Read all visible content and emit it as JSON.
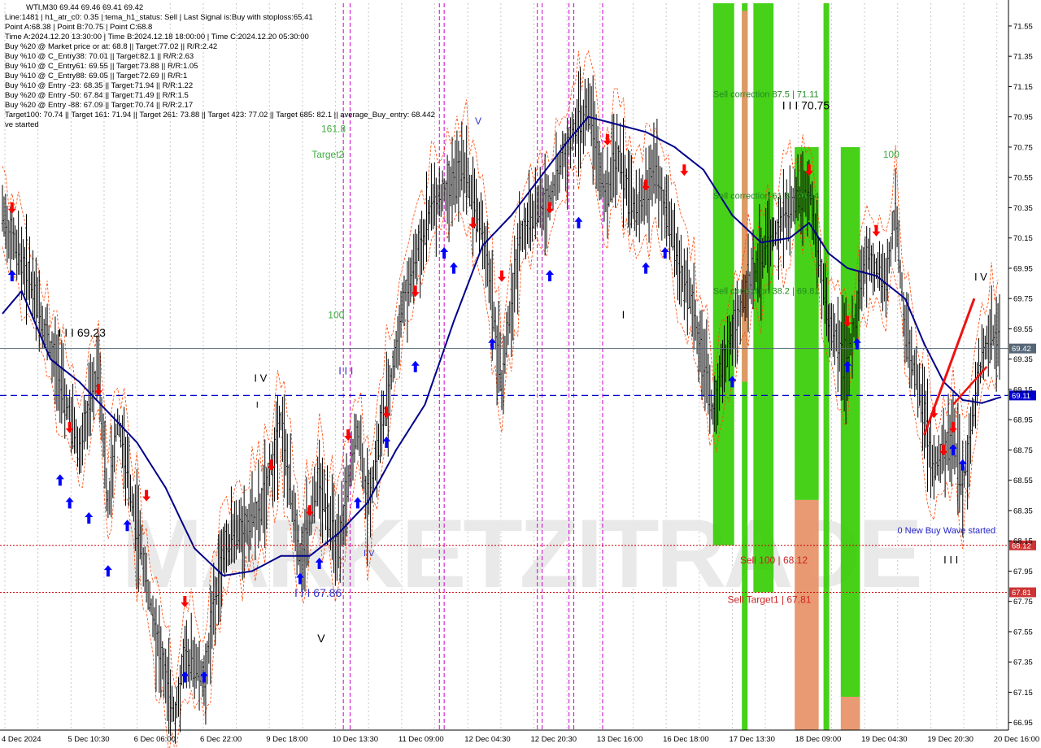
{
  "symbol_header": "WTI,M30  69.44 69.46 69.41 69.42",
  "info_lines": [
    "Line:1481  |  h1_atr_c0: 0.35  |  tema_h1_status: Sell  |  Last Signal is:Buy with stoploss:65.41",
    "Point A:68.38  |  Point B:70.75  |  Point C:68.8",
    "Time A:2024.12.20 13:30:00  |  Time B:2024.12.18 18:00:00  |  Time C:2024.12.20 05:30:00",
    "Buy %20 @ Market price or at: 68.8  ||  Target:77.02  ||  R/R:2.42",
    "Buy %10 @ C_Entry38: 70.01  ||  Target:82.1  ||  R/R:2.63",
    "Buy %10 @ C_Entry61: 69.55  ||  Target:73.88  ||  R/R:1.05",
    "Buy %10 @ C_Entry88: 69.05  ||  Target:72.69  ||  R/R:1",
    "Buy %10 @ Entry -23: 68.35  ||  Target:71.94  ||  R/R:1.22",
    "Buy %20 @ Entry -50: 67.84  ||  Target:71.49  ||  R/R:1.5",
    "Buy %20 @ Entry -88: 67.09  ||  Target:70.74  ||  R/R:2.17",
    "Target100: 70.74  ||  Target 161: 71.94  ||  Target 261: 73.88  ||  Target 423: 77.02  ||  Target 685: 82.1  ||  average_Buy_entry: 68.442",
    "ve started"
  ],
  "watermark": "MARKETZITRADE",
  "colors": {
    "price_bars": "#000000",
    "ma": "#00008b",
    "bands": "#ff4500",
    "green_zone": "#33cc00",
    "orange_zone": "#e8956a",
    "buy_arrow": "#0000ff",
    "sell_arrow": "#ff0000",
    "current_price": "#556677",
    "blue_level": "#0000cc",
    "red_level": "#cc0000",
    "magenta_vline": "#cc00cc",
    "grid": "#c8c8c8"
  },
  "chart_data": {
    "type": "candlestick",
    "title": "WTI,M30",
    "x_ticks": [
      "4 Dec 2024",
      "5 Dec 10:30",
      "6 Dec 06:00",
      "6 Dec 22:00",
      "9 Dec 18:00",
      "10 Dec 13:30",
      "11 Dec 09:00",
      "12 Dec 04:30",
      "12 Dec 20:30",
      "13 Dec 16:00",
      "16 Dec 18:00",
      "17 Dec 13:30",
      "18 Dec 09:00",
      "19 Dec 04:30",
      "19 Dec 20:30",
      "20 Dec 16:00"
    ],
    "y_ticks": [
      "71.55",
      "71.35",
      "71.15",
      "70.95",
      "70.75",
      "70.55",
      "70.35",
      "70.15",
      "69.95",
      "69.75",
      "69.55",
      "69.35",
      "69.15",
      "68.95",
      "68.75",
      "68.55",
      "68.35",
      "68.15",
      "67.95",
      "67.75",
      "67.55",
      "67.35",
      "67.15",
      "66.95"
    ],
    "ylim": [
      66.9,
      71.7
    ],
    "price_path": [
      [
        0,
        70.3
      ],
      [
        3,
        69.85
      ],
      [
        6,
        69.2
      ],
      [
        8,
        68.75
      ],
      [
        10,
        69.3
      ],
      [
        11,
        68.4
      ],
      [
        12,
        68.95
      ],
      [
        16,
        67.55
      ],
      [
        18,
        67.0
      ],
      [
        19,
        67.4
      ],
      [
        21,
        67.25
      ],
      [
        23,
        68.1
      ],
      [
        27,
        68.35
      ],
      [
        29,
        68.95
      ],
      [
        31,
        68.05
      ],
      [
        33,
        68.55
      ],
      [
        35,
        68.1
      ],
      [
        37,
        68.9
      ],
      [
        38,
        68.4
      ],
      [
        40,
        69.05
      ],
      [
        42,
        69.8
      ],
      [
        45,
        70.4
      ],
      [
        48,
        70.6
      ],
      [
        50,
        70.2
      ],
      [
        51,
        69.7
      ],
      [
        52,
        69.2
      ],
      [
        54,
        70.2
      ],
      [
        57,
        70.4
      ],
      [
        59,
        70.8
      ],
      [
        61,
        71.0
      ],
      [
        63,
        70.4
      ],
      [
        64,
        70.7
      ],
      [
        66,
        70.3
      ],
      [
        68,
        70.6
      ],
      [
        70,
        70.1
      ],
      [
        72,
        69.65
      ],
      [
        74,
        69.0
      ],
      [
        75,
        69.3
      ],
      [
        78,
        69.9
      ],
      [
        81,
        70.25
      ],
      [
        84,
        70.5
      ],
      [
        86,
        69.6
      ],
      [
        88,
        69.3
      ],
      [
        90,
        70.05
      ],
      [
        92,
        69.85
      ],
      [
        93,
        70.35
      ],
      [
        94,
        69.55
      ],
      [
        96,
        69.0
      ],
      [
        97,
        68.6
      ],
      [
        99,
        68.85
      ],
      [
        100,
        68.5
      ],
      [
        102,
        69.35
      ],
      [
        103,
        69.5
      ],
      [
        104,
        69.42
      ]
    ],
    "ma_path": [
      [
        0,
        69.65
      ],
      [
        2,
        69.8
      ],
      [
        5,
        69.35
      ],
      [
        8,
        69.2
      ],
      [
        11,
        69.0
      ],
      [
        14,
        68.8
      ],
      [
        17,
        68.5
      ],
      [
        20,
        68.1
      ],
      [
        23,
        67.92
      ],
      [
        26,
        67.95
      ],
      [
        29,
        68.05
      ],
      [
        32,
        68.05
      ],
      [
        35,
        68.2
      ],
      [
        38,
        68.4
      ],
      [
        41,
        68.75
      ],
      [
        44,
        69.05
      ],
      [
        47,
        69.6
      ],
      [
        50,
        70.1
      ],
      [
        53,
        70.3
      ],
      [
        56,
        70.55
      ],
      [
        59,
        70.8
      ],
      [
        61,
        70.95
      ],
      [
        64,
        70.9
      ],
      [
        67,
        70.85
      ],
      [
        70,
        70.75
      ],
      [
        73,
        70.6
      ],
      [
        76,
        70.3
      ],
      [
        79,
        70.12
      ],
      [
        82,
        70.15
      ],
      [
        84,
        70.25
      ],
      [
        86,
        70.05
      ],
      [
        88,
        69.95
      ],
      [
        91,
        69.9
      ],
      [
        94,
        69.75
      ],
      [
        96,
        69.45
      ],
      [
        98,
        69.2
      ],
      [
        100,
        69.08
      ],
      [
        102,
        69.06
      ],
      [
        104,
        69.1
      ]
    ],
    "current_price": 69.42,
    "current_price_label": "69.42",
    "blue_level": 69.11,
    "blue_level_label": "69.11",
    "red_levels": [
      {
        "value": 68.12,
        "label": "68.12"
      },
      {
        "value": 67.81,
        "label": "67.81"
      }
    ],
    "green_zones": [
      {
        "x_from": 74.0,
        "x_to": 76.2,
        "y_top": 71.7,
        "y_bottom": 68.12
      },
      {
        "x_from": 78.2,
        "x_to": 80.3,
        "y_top": 71.7,
        "y_bottom": 67.81
      },
      {
        "x_from": 85.5,
        "x_to": 86.1,
        "y_top": 71.7,
        "y_bottom": 66.9
      },
      {
        "x_from": 77.0,
        "x_to": 77.6,
        "y_top": 71.7,
        "y_bottom": 66.9
      },
      {
        "x_from": 82.5,
        "x_to": 85.0,
        "y_top": 70.75,
        "y_bottom": 68.42
      },
      {
        "x_from": 87.3,
        "x_to": 89.3,
        "y_top": 70.75,
        "y_bottom": 67.12
      }
    ],
    "orange_zones": [
      {
        "x_from": 82.5,
        "x_to": 85.0,
        "y_top": 68.42,
        "y_bottom": 66.9
      },
      {
        "x_from": 87.3,
        "x_to": 89.3,
        "y_top": 67.12,
        "y_bottom": 66.9
      },
      {
        "x_from": 77.0,
        "x_to": 77.6,
        "y_top": 71.65,
        "y_bottom": 69.2
      }
    ],
    "magenta_vlines": [
      35.5,
      36.2,
      45.5,
      46.0,
      55.7,
      56.2,
      59.0,
      59.5,
      62.5
    ],
    "buy_arrows": [
      [
        1,
        69.95
      ],
      [
        6,
        68.6
      ],
      [
        7,
        68.45
      ],
      [
        9,
        68.35
      ],
      [
        11,
        68.0
      ],
      [
        13,
        68.3
      ],
      [
        19,
        67.3
      ],
      [
        21,
        67.3
      ],
      [
        31,
        67.95
      ],
      [
        33,
        68.05
      ],
      [
        37,
        68.45
      ],
      [
        40,
        68.85
      ],
      [
        43,
        69.35
      ],
      [
        46,
        70.1
      ],
      [
        47,
        70.0
      ],
      [
        51,
        69.5
      ],
      [
        57,
        69.95
      ],
      [
        60,
        70.3
      ],
      [
        67,
        70.0
      ],
      [
        69,
        70.1
      ],
      [
        76,
        69.25
      ],
      [
        88,
        69.35
      ],
      [
        89,
        69.5
      ],
      [
        99,
        68.8
      ],
      [
        100,
        68.7
      ]
    ],
    "sell_arrows": [
      [
        1,
        70.3
      ],
      [
        7,
        68.85
      ],
      [
        10,
        69.1
      ],
      [
        15,
        68.4
      ],
      [
        19,
        67.7
      ],
      [
        28,
        68.6
      ],
      [
        32,
        68.3
      ],
      [
        36,
        68.8
      ],
      [
        40,
        68.95
      ],
      [
        43,
        69.75
      ],
      [
        49,
        70.2
      ],
      [
        52,
        69.85
      ],
      [
        57,
        70.3
      ],
      [
        63,
        70.75
      ],
      [
        67,
        70.45
      ],
      [
        71,
        70.55
      ],
      [
        84,
        70.55
      ],
      [
        88,
        69.55
      ],
      [
        91,
        70.15
      ],
      [
        97,
        68.95
      ],
      [
        98,
        68.7
      ],
      [
        99,
        68.85
      ]
    ],
    "red_trendline": [
      [
        96,
        68.85
      ],
      [
        101.2,
        69.75
      ]
    ],
    "red_trendline2": [
      [
        99.0,
        69.05
      ],
      [
        102.5,
        69.3
      ]
    ],
    "annotations": [
      {
        "text": "I I I 69.23",
        "x": 5.8,
        "y": 69.5,
        "color": "#000000",
        "size": 14
      },
      {
        "text": "I V",
        "x": 26.2,
        "y": 69.2,
        "color": "#000000",
        "size": 13
      },
      {
        "text": "I",
        "x": 26.4,
        "y": 69.03,
        "color": "#000000",
        "size": 11
      },
      {
        "text": "I I I",
        "x": 35.0,
        "y": 69.25,
        "color": "#3333cc",
        "size": 13
      },
      {
        "text": "I V",
        "x": 37.6,
        "y": 68.05,
        "color": "#3333cc",
        "size": 11
      },
      {
        "text": "I I I 67.86",
        "x": 30.4,
        "y": 67.78,
        "color": "#3333cc",
        "size": 14
      },
      {
        "text": "V",
        "x": 32.8,
        "y": 67.48,
        "color": "#000000",
        "size": 14
      },
      {
        "text": "161.8",
        "x": 33.2,
        "y": 70.85,
        "color": "#44aa44",
        "size": 12
      },
      {
        "text": "Target2",
        "x": 32.2,
        "y": 70.68,
        "color": "#44aa44",
        "size": 12
      },
      {
        "text": "100",
        "x": 33.9,
        "y": 69.62,
        "color": "#44aa44",
        "size": 12
      },
      {
        "text": "V",
        "x": 49.2,
        "y": 70.9,
        "color": "#3333cc",
        "size": 12
      },
      {
        "text": "I",
        "x": 64.5,
        "y": 69.62,
        "color": "#000000",
        "size": 13
      },
      {
        "text": "I I I 70.75",
        "x": 81.2,
        "y": 71.0,
        "color": "#000000",
        "size": 14
      },
      {
        "text": "100",
        "x": 91.7,
        "y": 70.68,
        "color": "#44aa44",
        "size": 12
      },
      {
        "text": "I V",
        "x": 101.2,
        "y": 69.87,
        "color": "#000000",
        "size": 13
      },
      {
        "text": "I I I",
        "x": 98.0,
        "y": 68.0,
        "color": "#000000",
        "size": 13
      },
      {
        "text": "Sell correction 87.5 | 71.11",
        "x": 74.0,
        "y": 71.08,
        "color": "#228822",
        "size": 11
      },
      {
        "text": "Sell correction 61.8 | 70.44",
        "x": 74.0,
        "y": 70.41,
        "color": "#228822",
        "size": 11
      },
      {
        "text": "Sell correction 38.2 | 69.81",
        "x": 74.0,
        "y": 69.78,
        "color": "#228822",
        "size": 11
      },
      {
        "text": "0 New Buy Wave started",
        "x": 93.2,
        "y": 68.2,
        "color": "#2222cc",
        "size": 11
      },
      {
        "text": "Sell 100 | 68.12",
        "x": 76.8,
        "y": 68.0,
        "color": "#cc2222",
        "size": 12
      },
      {
        "text": "Sell Target1 | 67.81",
        "x": 75.5,
        "y": 67.74,
        "color": "#cc2222",
        "size": 12
      }
    ]
  }
}
